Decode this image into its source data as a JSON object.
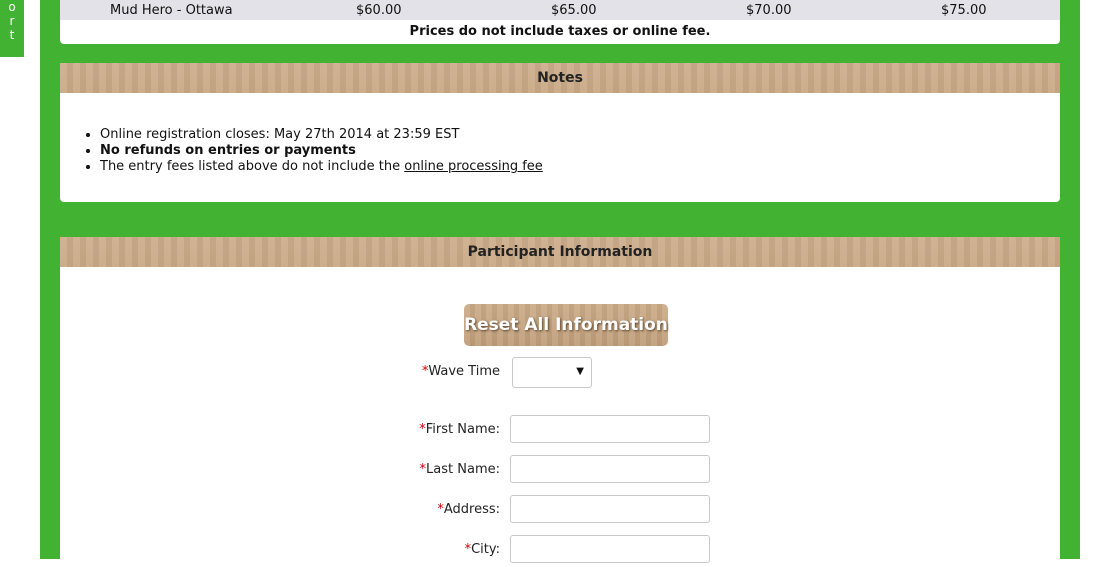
{
  "support_tab": {
    "letters": [
      "o",
      "r",
      "t"
    ]
  },
  "price_table": {
    "row": {
      "event": "Mud Hero - Ottawa",
      "prices": [
        "$60.00",
        "$65.00",
        "$70.00",
        "$75.00"
      ]
    },
    "note": "Prices do not include taxes or online fee."
  },
  "notes": {
    "title": "Notes",
    "items": [
      "Online registration closes: May 27th 2014 at 23:59 EST",
      "No refunds on entries or payments"
    ],
    "fee_item_prefix": "The entry fees listed above do not include the ",
    "fee_item_link": "online processing fee"
  },
  "participant": {
    "title": "Participant Information",
    "reset_button": "Reset All Information",
    "required_mark": "*",
    "wave_time_label": "Wave Time",
    "wave_time_value": "",
    "fields": {
      "first_name": "First Name:",
      "last_name": "Last Name:",
      "address": "Address:",
      "city": "City:"
    }
  },
  "colors": {
    "green": "#42b232",
    "tan": "#cbab88",
    "required": "#cc0000"
  }
}
